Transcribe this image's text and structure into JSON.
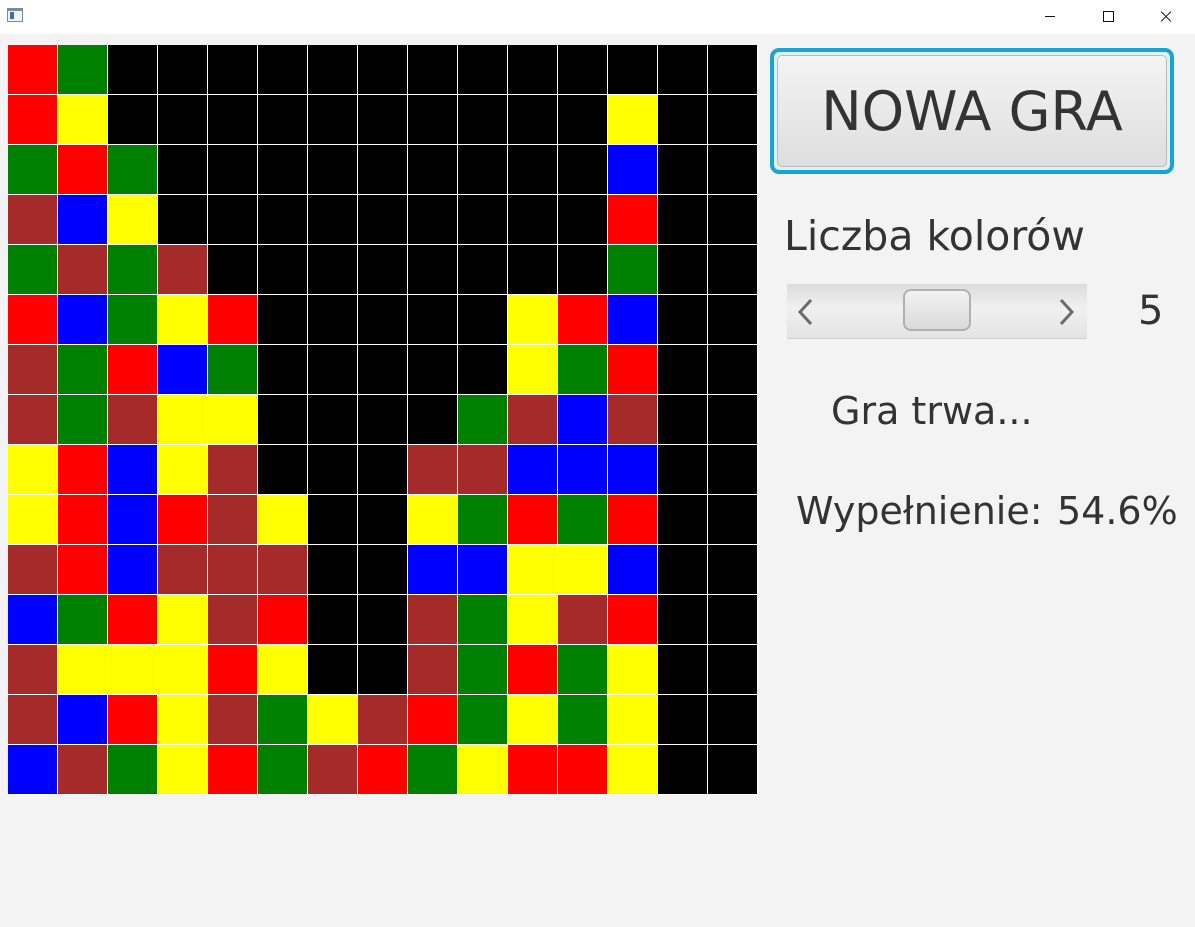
{
  "window": {
    "controls": [
      "minimize-icon",
      "maximize-icon",
      "close-icon"
    ]
  },
  "board": {
    "size": 15,
    "palette": {
      "K": "#000000",
      "R": "#ff0000",
      "G": "#008000",
      "Y": "#ffff00",
      "B": "#0000ff",
      "N": "#a52a2a"
    },
    "rows": [
      "RGKKKKKKKKKKKKK",
      "RYKKKKKKKKKKYKK",
      "GRGKKKKKKKKKBKK",
      "NBYKKKKKKKKKRKK",
      "GNGNKKKKKKKKGKK",
      "RBGYRKKKKKYRBKK",
      "NGRBGKKKKKYGRKK",
      "NGNYYKKKKGNBNKK",
      "YRBYNKKKNNBBBKK",
      "YRBRNYKKYGRGRKK",
      "NRBNNNKKBBYYBKK",
      "BGRYNRKKNGYNRKK",
      "NYYYRYKKNGRGYKK",
      "NBRYNGYNRGYGYKK",
      "BNGYRGNRGYRRYKK"
    ]
  },
  "controls": {
    "new_game_label": "NOWA GRA",
    "colors_label": "Liczba kolorów",
    "colors_value": "5",
    "colors_slider_level": 0.5,
    "status_text": "Gra trwa...",
    "fill_label": "Wypełnienie:",
    "fill_value": "54.6%"
  }
}
